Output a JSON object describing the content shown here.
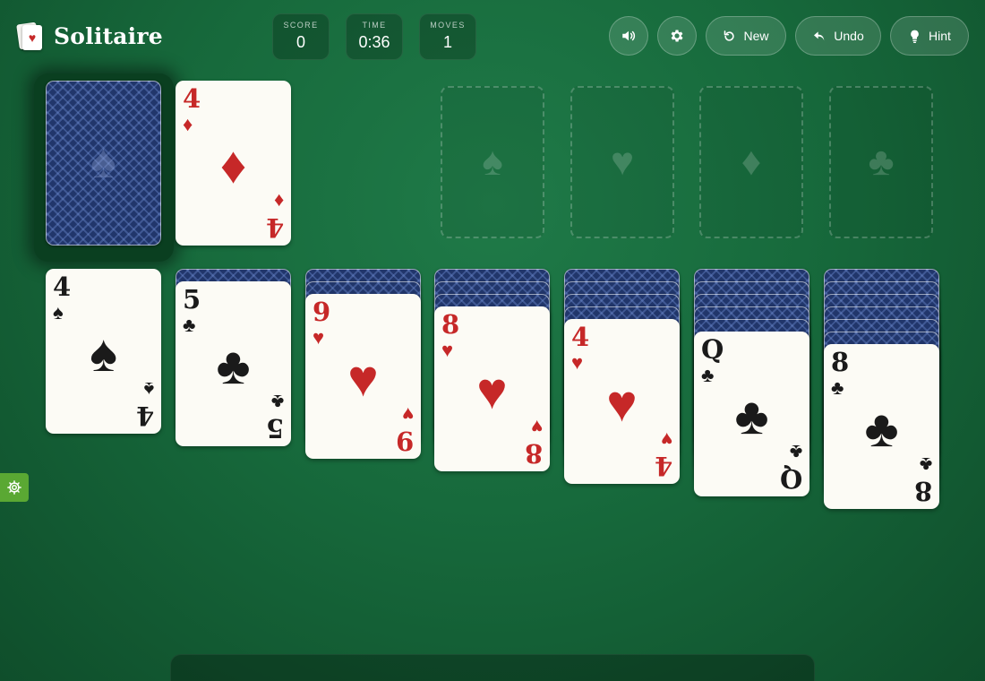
{
  "app": {
    "title": "Solitaire",
    "logo_suit": "♥"
  },
  "stats": {
    "score_label": "SCORE",
    "score_value": "0",
    "time_label": "TIME",
    "time_value": "0:36",
    "moves_label": "MOVES",
    "moves_value": "1"
  },
  "toolbar": {
    "sound_icon": "speaker-icon",
    "settings_icon": "gear-icon",
    "new_label": "New",
    "undo_label": "Undo",
    "hint_label": "Hint"
  },
  "colors": {
    "felt": "#176a3c",
    "card_red": "#c62828",
    "card_black": "#1a1a1a",
    "card_back": "#21366b",
    "side_gear": "#5aa833"
  },
  "stock": {
    "emblem": "♠"
  },
  "waste": {
    "rank": "4",
    "suit": "♦",
    "color": "red"
  },
  "foundations": [
    {
      "suit": "♠"
    },
    {
      "suit": "♥"
    },
    {
      "suit": "♦"
    },
    {
      "suit": "♣"
    }
  ],
  "tableau": [
    {
      "hidden": 0,
      "rank": "4",
      "suit": "♠",
      "color": "black"
    },
    {
      "hidden": 1,
      "rank": "5",
      "suit": "♣",
      "color": "black"
    },
    {
      "hidden": 2,
      "rank": "9",
      "suit": "♥",
      "color": "red"
    },
    {
      "hidden": 3,
      "rank": "8",
      "suit": "♥",
      "color": "red"
    },
    {
      "hidden": 4,
      "rank": "4",
      "suit": "♥",
      "color": "red"
    },
    {
      "hidden": 5,
      "rank": "Q",
      "suit": "♣",
      "color": "black"
    },
    {
      "hidden": 6,
      "rank": "8",
      "suit": "♣",
      "color": "black"
    }
  ]
}
